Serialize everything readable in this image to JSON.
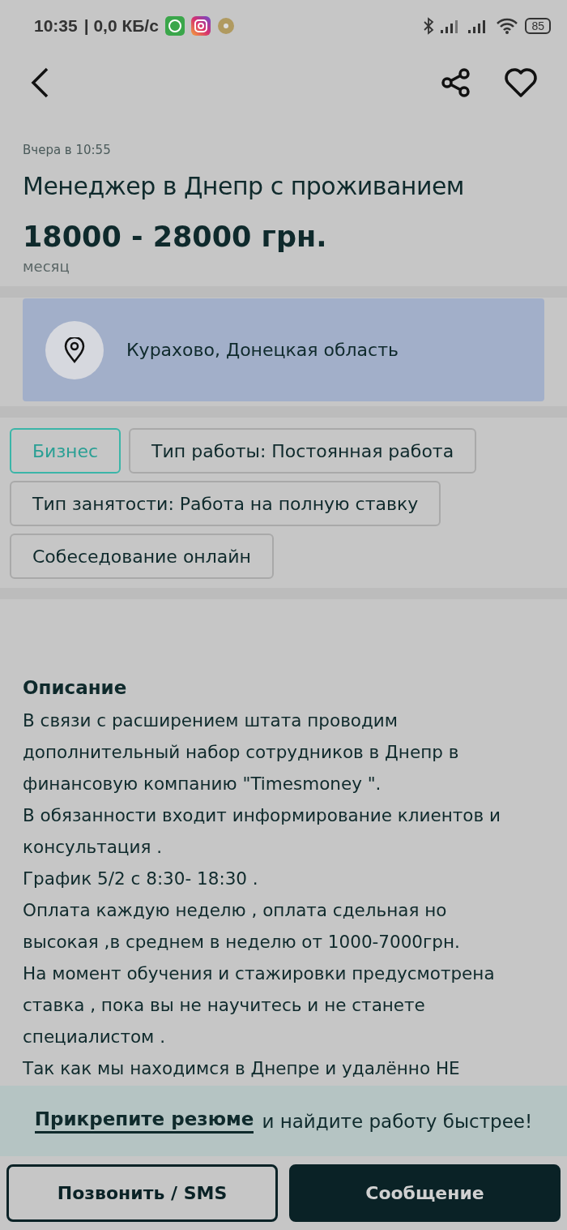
{
  "status_bar": {
    "time": "10:35",
    "speed": "| 0,0 КБ/с",
    "battery": "85"
  },
  "ad": {
    "date": "Вчера в 10:55",
    "title": "Менеджер в Днепр с проживанием",
    "price": "18000 - 28000 грн.",
    "period": "месяц"
  },
  "location": "Курахово, Донецкая область",
  "tags": [
    {
      "label": "Бизнес",
      "highlighted": true
    },
    {
      "label": "Тип работы: Постоянная работа",
      "highlighted": false
    },
    {
      "label": "Тип занятости: Работа на полную ставку",
      "highlighted": false
    },
    {
      "label": "Собеседование онлайн",
      "highlighted": false
    }
  ],
  "description": {
    "heading": "Описание",
    "paragraphs": [
      "В связи с расширением штата проводим дополнительный набор сотрудников в Днепр в финансовую компанию \"Timesmoney \".",
      "В обязанности входит информирование клиентов и консультация .",
      "График 5/2 с 8:30- 18:30 .",
      "Оплата каждую неделю , оплата сдельная но высокая ,в среднем в неделю от 1000-7000грн.",
      "На момент обучения и стажировки предусмотрена ставка , пока вы не научитесь и не станете специалистом .",
      "Так как мы находимся в Днепре и удалённо НЕ"
    ]
  },
  "banner": {
    "link": "Прикрепите резюме",
    "text": "и найдите работу быстрее!"
  },
  "buttons": {
    "call": "Позвонить / SMS",
    "message": "Сообщение"
  }
}
